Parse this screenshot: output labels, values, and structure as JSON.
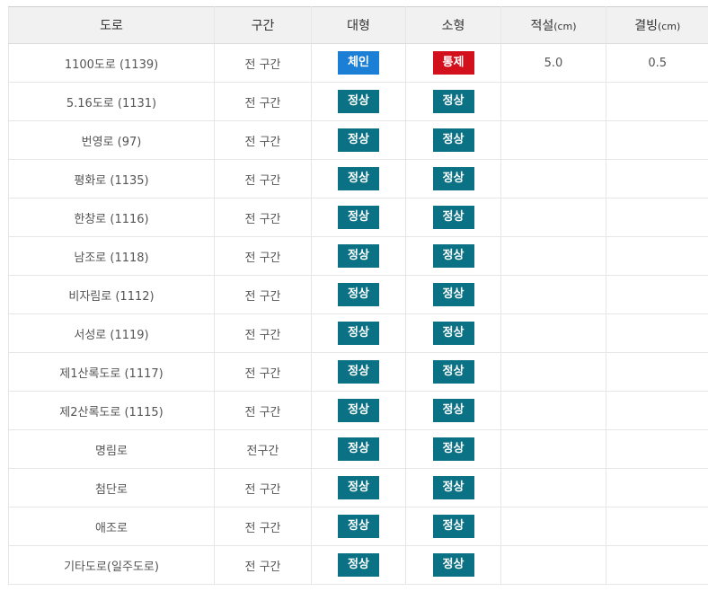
{
  "colors": {
    "normal": "#0b7285",
    "chain": "#1c7fd6",
    "control": "#d3111c"
  },
  "table": {
    "headers": {
      "road": "도로",
      "section": "구간",
      "large": "대형",
      "small": "소형",
      "snow": "적설",
      "snow_unit": "(cm)",
      "ice": "결빙",
      "ice_unit": "(cm)"
    },
    "rows": [
      {
        "road": "1100도로 (1139)",
        "section": "전 구간",
        "large": "체인",
        "large_status": "chain",
        "small": "통제",
        "small_status": "control",
        "snow": "5.0",
        "ice": "0.5"
      },
      {
        "road": "5.16도로 (1131)",
        "section": "전 구간",
        "large": "정상",
        "large_status": "normal",
        "small": "정상",
        "small_status": "normal",
        "snow": "",
        "ice": ""
      },
      {
        "road": "번영로 (97)",
        "section": "전 구간",
        "large": "정상",
        "large_status": "normal",
        "small": "정상",
        "small_status": "normal",
        "snow": "",
        "ice": ""
      },
      {
        "road": "평화로 (1135)",
        "section": "전 구간",
        "large": "정상",
        "large_status": "normal",
        "small": "정상",
        "small_status": "normal",
        "snow": "",
        "ice": ""
      },
      {
        "road": "한창로 (1116)",
        "section": "전 구간",
        "large": "정상",
        "large_status": "normal",
        "small": "정상",
        "small_status": "normal",
        "snow": "",
        "ice": ""
      },
      {
        "road": "남조로 (1118)",
        "section": "전 구간",
        "large": "정상",
        "large_status": "normal",
        "small": "정상",
        "small_status": "normal",
        "snow": "",
        "ice": ""
      },
      {
        "road": "비자림로 (1112)",
        "section": "전 구간",
        "large": "정상",
        "large_status": "normal",
        "small": "정상",
        "small_status": "normal",
        "snow": "",
        "ice": ""
      },
      {
        "road": "서성로 (1119)",
        "section": "전 구간",
        "large": "정상",
        "large_status": "normal",
        "small": "정상",
        "small_status": "normal",
        "snow": "",
        "ice": ""
      },
      {
        "road": "제1산록도로 (1117)",
        "section": "전 구간",
        "large": "정상",
        "large_status": "normal",
        "small": "정상",
        "small_status": "normal",
        "snow": "",
        "ice": ""
      },
      {
        "road": "제2산록도로 (1115)",
        "section": "전 구간",
        "large": "정상",
        "large_status": "normal",
        "small": "정상",
        "small_status": "normal",
        "snow": "",
        "ice": ""
      },
      {
        "road": "명림로",
        "section": "전구간",
        "large": "정상",
        "large_status": "normal",
        "small": "정상",
        "small_status": "normal",
        "snow": "",
        "ice": ""
      },
      {
        "road": "첨단로",
        "section": "전 구간",
        "large": "정상",
        "large_status": "normal",
        "small": "정상",
        "small_status": "normal",
        "snow": "",
        "ice": ""
      },
      {
        "road": "애조로",
        "section": "전 구간",
        "large": "정상",
        "large_status": "normal",
        "small": "정상",
        "small_status": "normal",
        "snow": "",
        "ice": ""
      },
      {
        "road": "기타도로(일주도로)",
        "section": "전 구간",
        "large": "정상",
        "large_status": "normal",
        "small": "정상",
        "small_status": "normal",
        "snow": "",
        "ice": ""
      }
    ]
  }
}
